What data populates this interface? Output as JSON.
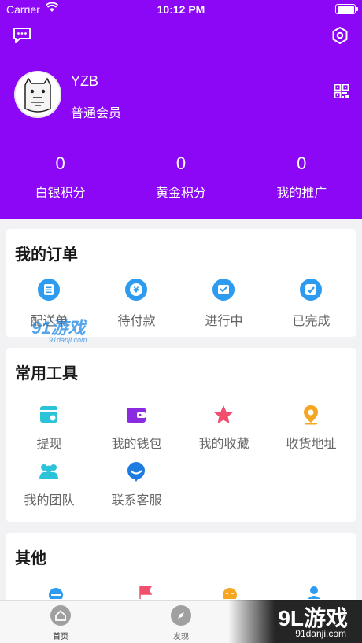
{
  "status_bar": {
    "carrier": "Carrier",
    "time": "10:12 PM"
  },
  "profile": {
    "username": "YZB",
    "level": "普通会员"
  },
  "stats": [
    {
      "value": "0",
      "label": "白银积分"
    },
    {
      "value": "0",
      "label": "黄金积分"
    },
    {
      "value": "0",
      "label": "我的推广"
    }
  ],
  "orders": {
    "title": "我的订单",
    "items": [
      {
        "label": "配送单",
        "icon": "doc-icon"
      },
      {
        "label": "待付款",
        "icon": "yen-icon"
      },
      {
        "label": "进行中",
        "icon": "progress-icon"
      },
      {
        "label": "已完成",
        "icon": "check-icon"
      }
    ]
  },
  "tools": {
    "title": "常用工具",
    "items": [
      {
        "label": "提现",
        "icon": "withdraw-icon"
      },
      {
        "label": "我的钱包",
        "icon": "wallet-icon"
      },
      {
        "label": "我的收藏",
        "icon": "star-icon"
      },
      {
        "label": "收货地址",
        "icon": "location-icon"
      },
      {
        "label": "我的团队",
        "icon": "team-icon"
      },
      {
        "label": "联系客服",
        "icon": "service-icon"
      }
    ]
  },
  "others": {
    "title": "其他"
  },
  "tabbar": [
    {
      "label": "首页",
      "icon": "home-icon"
    },
    {
      "label": "发现",
      "icon": "compass-icon"
    }
  ],
  "watermark": {
    "text": "91游戏",
    "url": "91danji.com"
  },
  "brand": {
    "logo": "9L游戏",
    "url": "91danji.com"
  },
  "colors": {
    "header": "#8b07f5",
    "order_icon": "#2d9cf0",
    "wallet": "#8a2be2",
    "star": "#f0506e",
    "location": "#f5a623",
    "team": "#2bc3d8"
  }
}
